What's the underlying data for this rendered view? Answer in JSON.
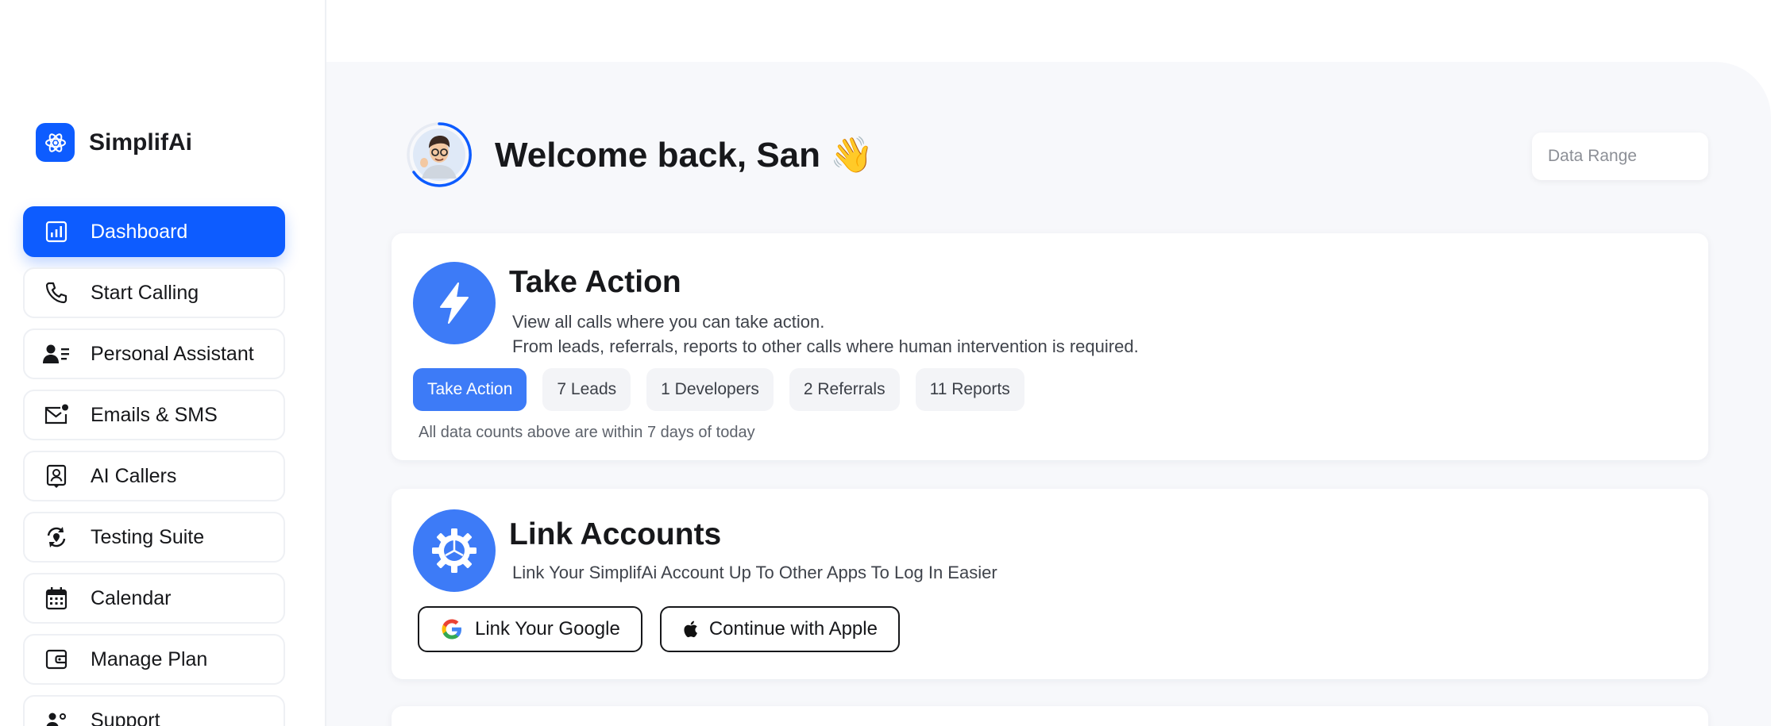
{
  "brand": {
    "name": "SimplifAi",
    "logo_icon": "atom-icon",
    "accent": "#0d5cff"
  },
  "sidebar": {
    "items": [
      {
        "label": "Dashboard",
        "icon": "bar-chart-icon",
        "active": true
      },
      {
        "label": "Start Calling",
        "icon": "phone-icon",
        "active": false
      },
      {
        "label": "Personal Assistant",
        "icon": "user-list-icon",
        "active": false
      },
      {
        "label": "Emails & SMS",
        "icon": "mail-icon",
        "active": false
      },
      {
        "label": "AI Callers",
        "icon": "id-card-icon",
        "active": false
      },
      {
        "label": "Testing Suite",
        "icon": "refresh-pin-icon",
        "active": false
      },
      {
        "label": "Calendar",
        "icon": "calendar-icon",
        "active": false
      },
      {
        "label": "Manage Plan",
        "icon": "wallet-icon",
        "active": false
      },
      {
        "label": "Support",
        "icon": "support-icon",
        "active": false
      }
    ]
  },
  "header": {
    "welcome": "Welcome back, San 👋",
    "date_range_placeholder": "Data Range"
  },
  "take_action": {
    "title": "Take Action",
    "icon": "lightning-icon",
    "desc_line1": "View all calls where you can take action.",
    "desc_line2": "From leads, referrals, reports to other calls where human intervention is required.",
    "chips": [
      {
        "label": "Take Action",
        "active": true
      },
      {
        "label": "7 Leads",
        "active": false
      },
      {
        "label": "1 Developers",
        "active": false
      },
      {
        "label": "2 Referrals",
        "active": false
      },
      {
        "label": "11 Reports",
        "active": false
      }
    ],
    "note": "All data counts above are within 7 days of today"
  },
  "link_accounts": {
    "title": "Link Accounts",
    "icon": "gear-icon",
    "desc": "Link Your SimplifAi Account Up To Other Apps To Log In Easier",
    "google_label": "Link Your Google",
    "apple_label": "Continue with Apple"
  }
}
